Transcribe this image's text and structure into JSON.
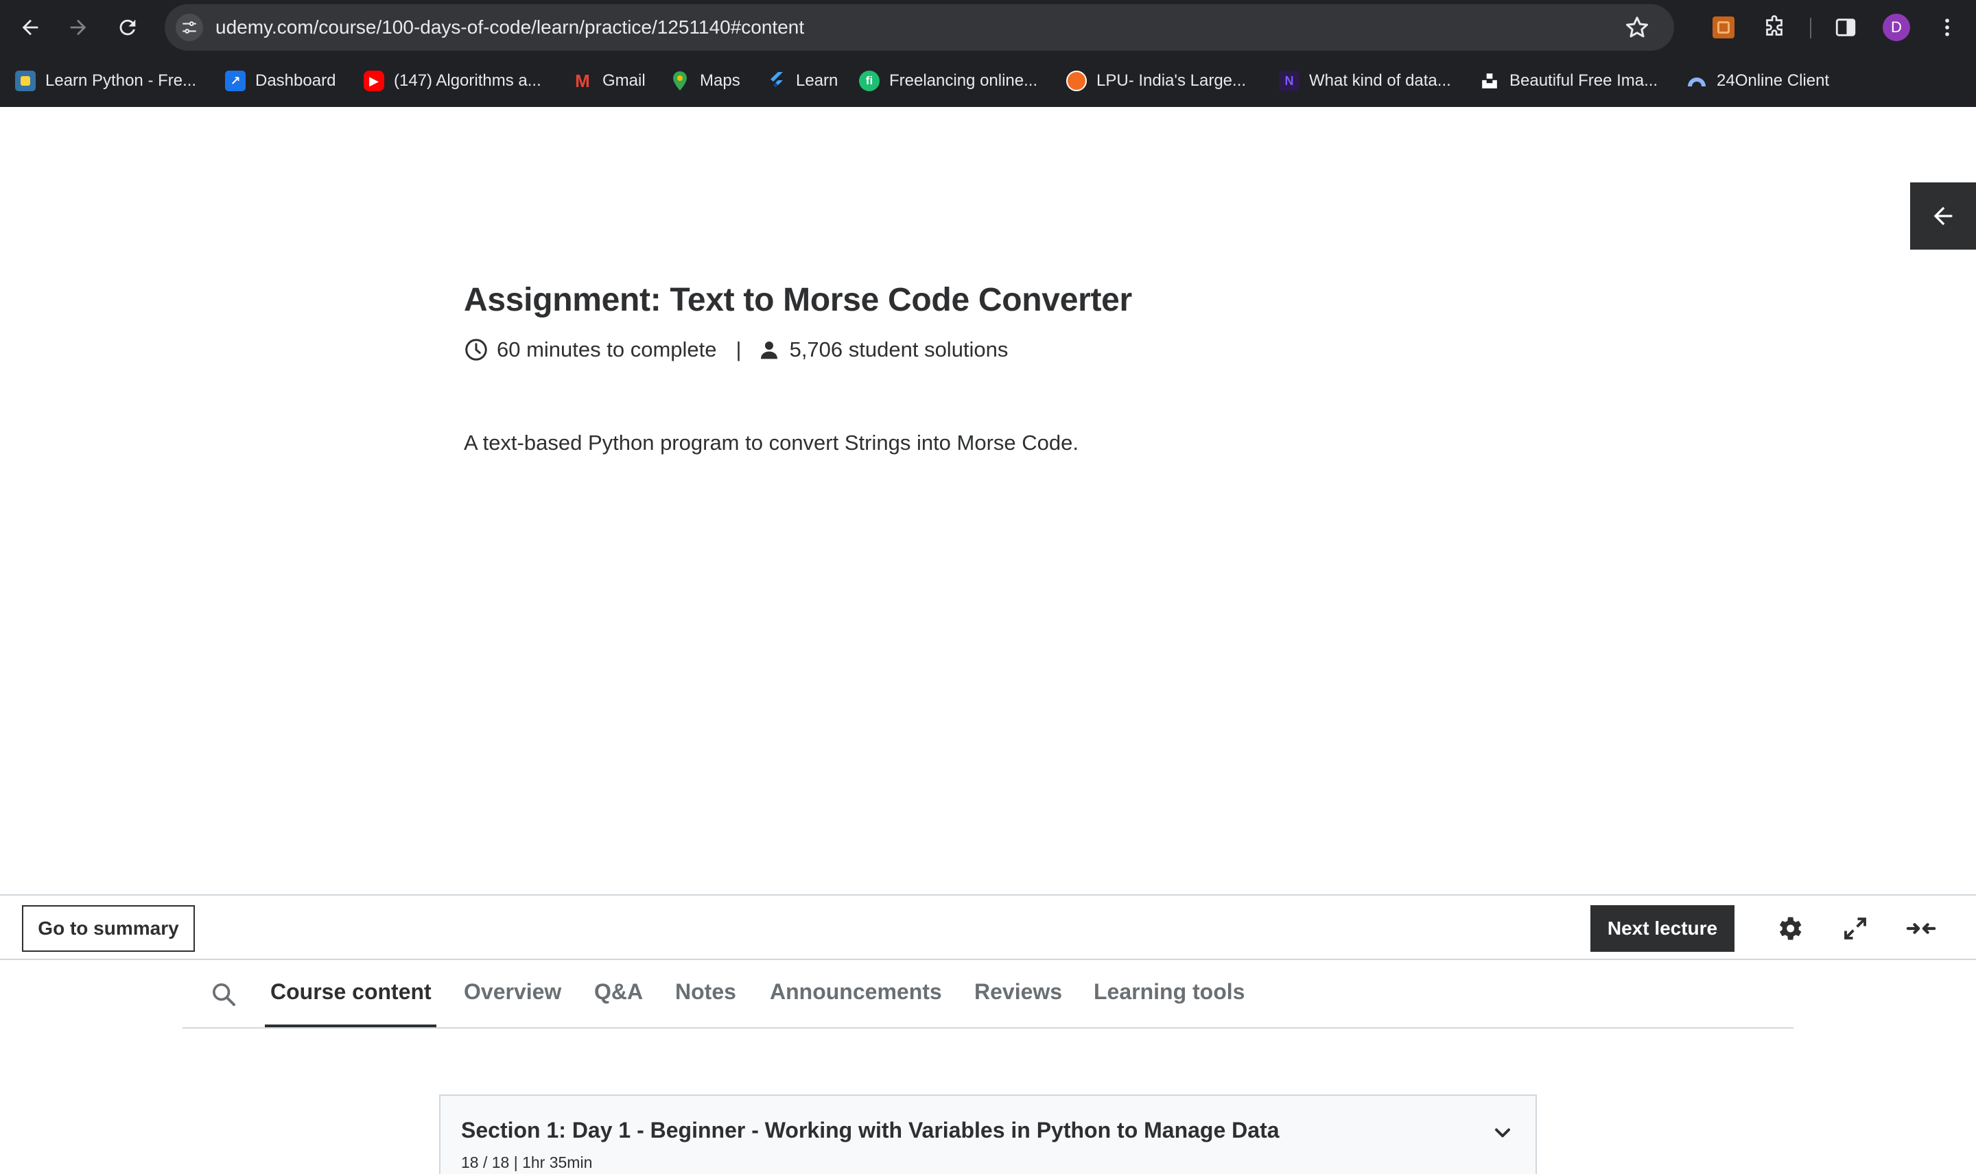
{
  "browser": {
    "url": "udemy.com/course/100-days-of-code/learn/practice/1251140#content",
    "profile_initial": "D",
    "bookmarks": [
      {
        "label": "Learn Python - Fre...",
        "icon": "python-icon"
      },
      {
        "label": "Dashboard",
        "icon": "dashboard-icon"
      },
      {
        "label": "(147) Algorithms a...",
        "icon": "youtube-icon"
      },
      {
        "label": "Gmail",
        "icon": "gmail-icon"
      },
      {
        "label": "Maps",
        "icon": "maps-icon"
      },
      {
        "label": "Learn",
        "icon": "flutter-icon"
      },
      {
        "label": "Freelancing online...",
        "icon": "fiverr-icon"
      },
      {
        "label": "LPU- India's Large...",
        "icon": "lpu-icon"
      },
      {
        "label": "What kind of data...",
        "icon": "data-icon"
      },
      {
        "label": "Beautiful Free Ima...",
        "icon": "unsplash-icon"
      },
      {
        "label": "24Online Client",
        "icon": "cloud-icon"
      }
    ]
  },
  "assignment": {
    "title": "Assignment: Text to Morse Code Converter",
    "duration": "60 minutes to complete",
    "separator": "|",
    "solutions": "5,706 student solutions",
    "description": "A text-based Python program to convert Strings into Morse Code."
  },
  "controls": {
    "summary_label": "Go to summary",
    "next_label": "Next lecture"
  },
  "tabs": [
    {
      "label": "Course content",
      "active": true
    },
    {
      "label": "Overview",
      "active": false
    },
    {
      "label": "Q&A",
      "active": false
    },
    {
      "label": "Notes",
      "active": false
    },
    {
      "label": "Announcements",
      "active": false
    },
    {
      "label": "Reviews",
      "active": false
    },
    {
      "label": "Learning tools",
      "active": false
    }
  ],
  "section": {
    "title": "Section 1: Day 1 - Beginner - Working with Variables in Python to Manage Data",
    "meta": "18 / 18 | 1hr 35min"
  },
  "colors": {
    "chrome_bg": "#202124",
    "omnibox_bg": "#35363a",
    "text_dark": "#2d2f31",
    "text_muted": "#6a6f73",
    "border": "#d1d7dc",
    "section_bg": "#f7f9fa"
  }
}
